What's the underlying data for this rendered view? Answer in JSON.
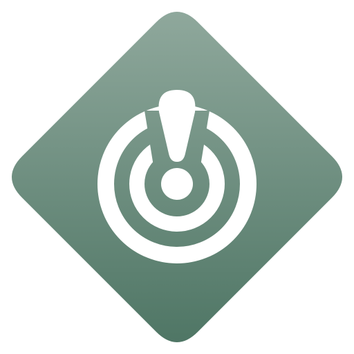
{
  "icon": {
    "name": "alert-target-icon",
    "shape": "rounded-diamond",
    "colors": {
      "background_top": "#8fa89c",
      "background_bottom": "#4f7665",
      "foreground": "#ffffff"
    }
  }
}
